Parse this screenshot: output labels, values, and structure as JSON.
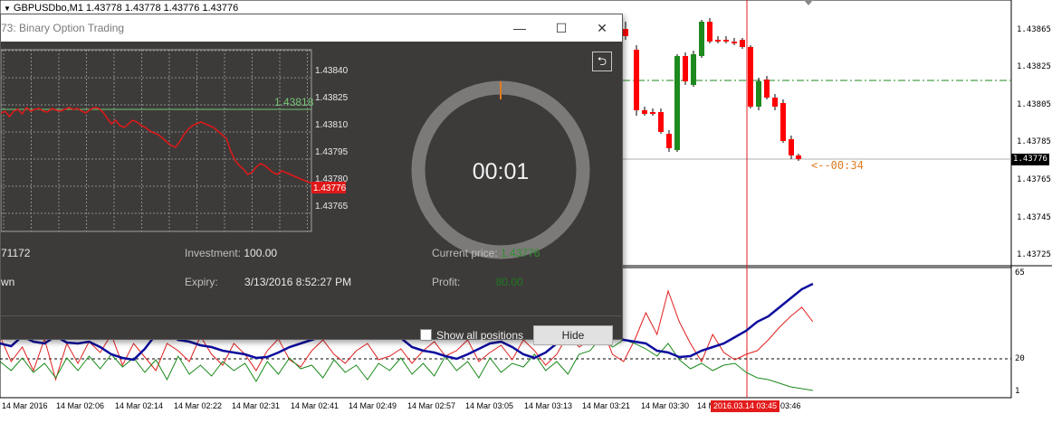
{
  "chart_window": {
    "title": "GBPUSDbo,M1  1.43778 1.43778 1.43776 1.43776",
    "price_ticks": [
      "1.43865",
      "1.43825",
      "1.43805",
      "1.43785",
      "1.43765",
      "1.43745",
      "1.43725"
    ],
    "current_price": "1.43776",
    "countdown": "<--00:34",
    "indicator_ticks": [
      "65",
      "20",
      "1"
    ],
    "time_ticks": [
      "14 Mar 2016",
      "14 Mar 02:06",
      "14 Mar 02:14",
      "14 Mar 02:22",
      "14 Mar 02:31",
      "14 Mar 02:41",
      "14 Mar 02:49",
      "14 Mar 02:57",
      "14 Mar 03:05",
      "14 Mar 03:13",
      "14 Mar 03:21",
      "14 Mar 03:30",
      "14 Mar 03:38",
      "03:46"
    ],
    "crosshair_time": "2016.03.14 03:45"
  },
  "dialog": {
    "title": "73: Binary Option Trading",
    "minimize_glyph": "—",
    "maximize_glyph": "☐",
    "close_glyph": "✕",
    "back_glyph": "⮌",
    "mini_chart": {
      "price_ticks": [
        "1.43840",
        "1.43825",
        "1.43810",
        "1.43795",
        "1.43780",
        "1.43765"
      ],
      "open_price_label": "1.43818",
      "current_price_label": "1.43776"
    },
    "timer": "00:01",
    "info": {
      "id_value": "71172",
      "direction_value": "wn",
      "investment_label": "Investment:",
      "investment_value": "100.00",
      "expiry_label": "Expiry:",
      "expiry_value": "3/13/2016 8:52:27 PM",
      "current_price_label": "Current price:",
      "current_price_value": "1.43776",
      "profit_label": "Profit:",
      "profit_value": "80.00"
    },
    "show_all_label": "Show all positions",
    "hide_label": "Hide"
  },
  "colors": {
    "bull": "#1e8a1e",
    "bear": "#ff0000",
    "main_line": "#0d0d9e",
    "signal_line": "#e02020",
    "third_line": "#1a8a1a",
    "accent_orange": "#e07b21"
  }
}
